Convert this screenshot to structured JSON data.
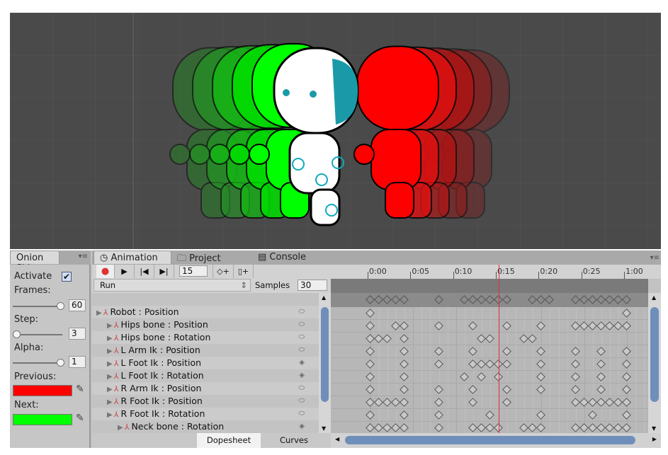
{
  "onion_panel": {
    "tab_label": "Onion Ski",
    "activate_label": "Activate",
    "activate_checked": true,
    "frames_label": "Frames:",
    "frames_value": "60",
    "step_label": "Step:",
    "step_value": "3",
    "alpha_label": "Alpha:",
    "alpha_value": "1",
    "previous_label": "Previous:",
    "previous_color": "#ff0000",
    "next_label": "Next:",
    "next_color": "#00ff00"
  },
  "tabs": [
    {
      "label": "Animation",
      "icon": "clock-icon",
      "active": true
    },
    {
      "label": "Project",
      "icon": "folder-icon",
      "active": false
    },
    {
      "label": "Console",
      "icon": "console-icon",
      "active": false
    }
  ],
  "toolbar": {
    "frame_value": "15",
    "clip_name": "Run",
    "samples_label": "Samples",
    "samples_value": "30"
  },
  "timeline": {
    "ticks": [
      "0:00",
      "0:05",
      "0:10",
      "0:15",
      "0:20",
      "0:25",
      "1:00"
    ],
    "current_frame": 15,
    "total_frames": 30,
    "summary_keys": [
      0,
      1,
      2,
      3,
      4,
      8,
      11,
      12,
      13,
      14,
      15,
      16,
      19,
      20,
      21,
      24,
      25,
      26,
      27,
      28,
      29,
      30
    ]
  },
  "properties": [
    {
      "label": "Robot : Position",
      "indent": 0,
      "keys": [
        0,
        30
      ],
      "icon": "oval"
    },
    {
      "label": "Hips bone : Position",
      "indent": 1,
      "keys": [
        0,
        3,
        4,
        8,
        12,
        16,
        20,
        24,
        25,
        26,
        27,
        28,
        29,
        30
      ],
      "icon": "oval"
    },
    {
      "label": "Hips bone : Rotation",
      "indent": 1,
      "keys": [
        0,
        1,
        2,
        4,
        13,
        14,
        18,
        19
      ],
      "icon": "oval"
    },
    {
      "label": "L Arm Ik : Position",
      "indent": 1,
      "keys": [
        0,
        4,
        8,
        12,
        16,
        20,
        24,
        27,
        30
      ],
      "icon": "oval"
    },
    {
      "label": "L Foot Ik : Position",
      "indent": 1,
      "keys": [
        0,
        4,
        8,
        12,
        13,
        14,
        15,
        16,
        20,
        24,
        27,
        30
      ],
      "icon": "diamond"
    },
    {
      "label": "L Foot Ik : Rotation",
      "indent": 1,
      "keys": [
        0,
        4,
        11,
        13,
        15,
        20,
        24,
        27,
        30
      ],
      "icon": "diamond"
    },
    {
      "label": "R Arm Ik : Position",
      "indent": 1,
      "keys": [
        0,
        4,
        8,
        12,
        16,
        20,
        24,
        27,
        30
      ],
      "icon": "oval"
    },
    {
      "label": "R Foot Ik : Position",
      "indent": 1,
      "keys": [
        0,
        1,
        2,
        3,
        4,
        8,
        12,
        16,
        24,
        25,
        26,
        27,
        28,
        29,
        30
      ],
      "icon": "oval"
    },
    {
      "label": "R Foot Ik : Rotation",
      "indent": 1,
      "keys": [
        0,
        4,
        8,
        14,
        20,
        26,
        30
      ],
      "icon": "oval"
    },
    {
      "label": "Neck bone : Rotation",
      "indent": 2,
      "keys": [
        0,
        1,
        2,
        3,
        4,
        8,
        12,
        13,
        14,
        15,
        18,
        19,
        20,
        24,
        25,
        26,
        27,
        28,
        29,
        30
      ],
      "icon": "diamond"
    }
  ],
  "bottom_tabs": {
    "dopesheet": "Dopesheet",
    "curves": "Curves"
  }
}
